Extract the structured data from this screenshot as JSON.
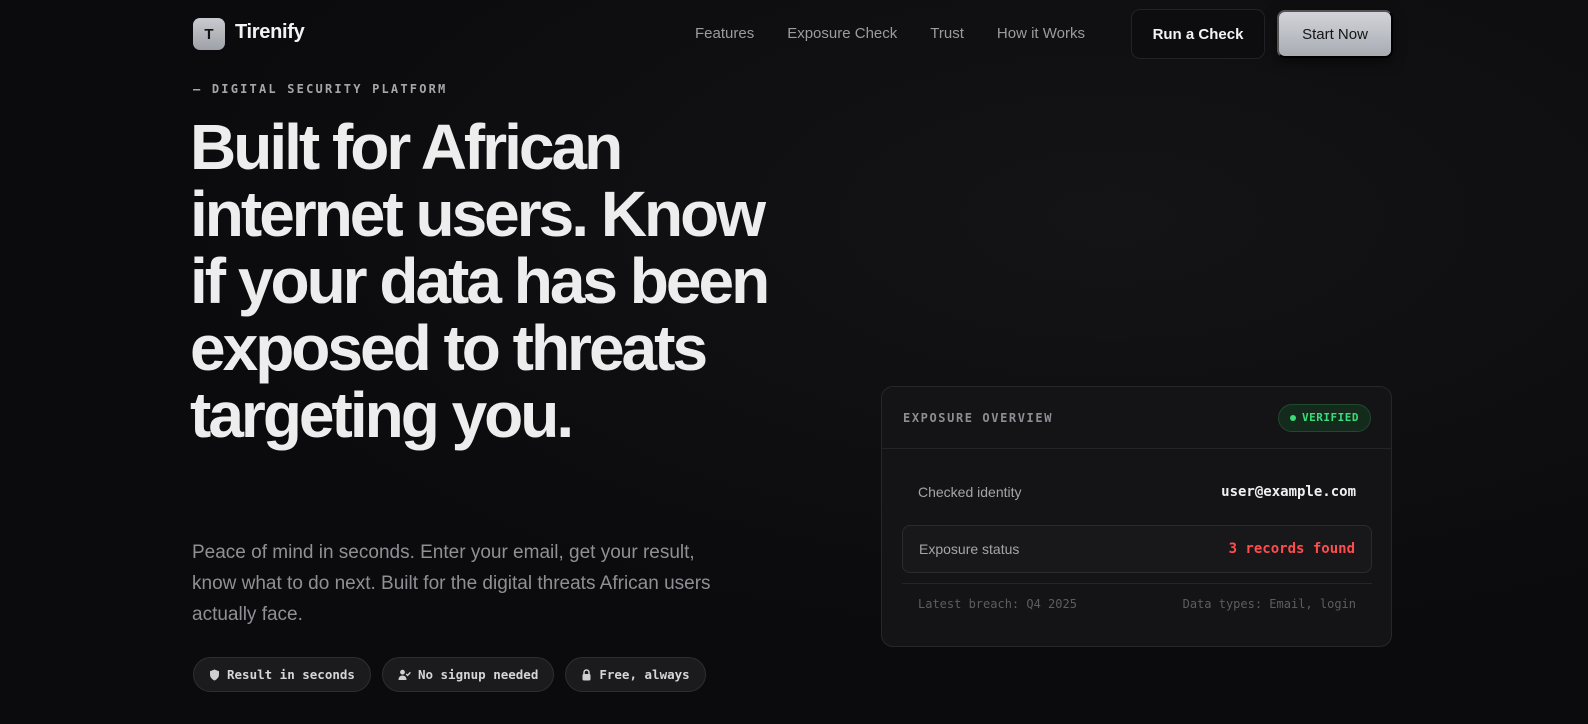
{
  "brand": {
    "initial": "T",
    "name": "Tirenify"
  },
  "nav": {
    "links": [
      "Features",
      "Exposure Check",
      "Trust",
      "How it Works"
    ],
    "run_check_label": "Run a Check",
    "start_now_label": "Start Now"
  },
  "hero": {
    "eyebrow": "— DIGITAL SECURITY PLATFORM",
    "headline": "Built for African internet users. Know if your data has been exposed to threats targeting you.",
    "subtitle": "Peace of mind in seconds. Enter your email, get your result, know what to do next. Built for the digital threats African users actually face.",
    "pills": [
      {
        "icon": "shield-icon",
        "label": "Result in seconds"
      },
      {
        "icon": "user-check-icon",
        "label": "No signup needed"
      },
      {
        "icon": "lock-icon",
        "label": "Free, always"
      }
    ]
  },
  "card": {
    "title": "EXPOSURE OVERVIEW",
    "badge": "VERIFIED",
    "identity_label": "Checked identity",
    "identity_value": "user@example.com",
    "status_label": "Exposure status",
    "status_value": "3 records found",
    "latest_breach": "Latest breach: Q4 2025",
    "data_types": "Data types: Email, login"
  },
  "colors": {
    "background": "#0b0b0d",
    "accent_green": "#3ddc7a",
    "alert_red": "#ff4d4d",
    "button_silver": "#bfc1c6"
  }
}
